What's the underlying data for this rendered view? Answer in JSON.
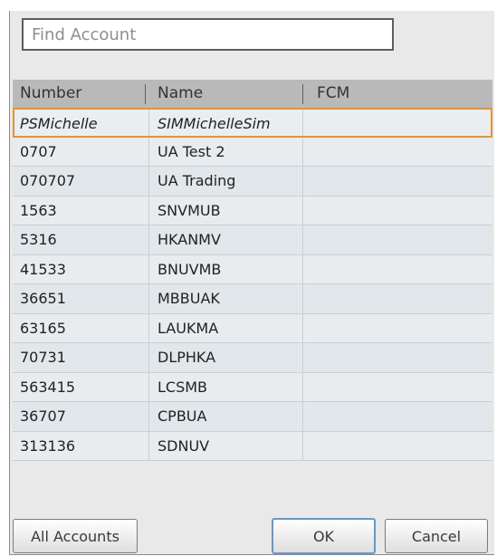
{
  "search": {
    "placeholder": "Find Account"
  },
  "columns": [
    "Number",
    "Name",
    "FCM"
  ],
  "rows": [
    {
      "number": "PSMichelle",
      "name": "SIMMichelleSim",
      "fcm": "",
      "selected": true
    },
    {
      "number": "0707",
      "name": "UA Test 2",
      "fcm": ""
    },
    {
      "number": "070707",
      "name": "UA Trading",
      "fcm": ""
    },
    {
      "number": "1563",
      "name": "SNVMUB",
      "fcm": ""
    },
    {
      "number": "5316",
      "name": "HKANMV",
      "fcm": ""
    },
    {
      "number": "41533",
      "name": "BNUVMB",
      "fcm": ""
    },
    {
      "number": "36651",
      "name": "MBBUAK",
      "fcm": ""
    },
    {
      "number": "63165",
      "name": "LAUKMA",
      "fcm": ""
    },
    {
      "number": "70731",
      "name": "DLPHKA",
      "fcm": ""
    },
    {
      "number": "563415",
      "name": "LCSMB",
      "fcm": ""
    },
    {
      "number": "36707",
      "name": "CPBUA",
      "fcm": ""
    },
    {
      "number": "313136",
      "name": "SDNUV",
      "fcm": ""
    }
  ],
  "buttons": {
    "all_accounts": "All Accounts",
    "ok": "OK",
    "cancel": "Cancel"
  },
  "colors": {
    "selection_border": "#e3933a",
    "ok_focus_border": "#6a98c7",
    "header_bg": "#b9b9b9"
  }
}
